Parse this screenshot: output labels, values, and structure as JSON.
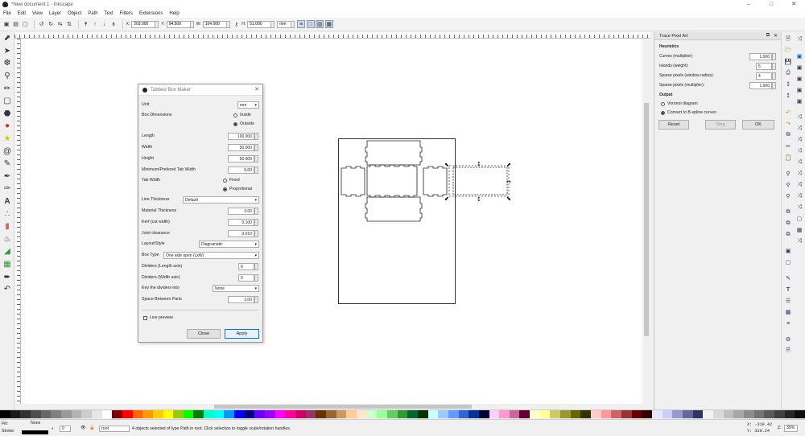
{
  "window": {
    "title": "*New document 1 - Inkscape",
    "controls": [
      "minimize-icon",
      "maximize-icon",
      "close-icon"
    ]
  },
  "menu": [
    "File",
    "Edit",
    "View",
    "Layer",
    "Object",
    "Path",
    "Text",
    "Filters",
    "Extensions",
    "Help"
  ],
  "toolbar": {
    "x_label": "X:",
    "x_value": "203.000",
    "y_label": "Y:",
    "y_value": "94.500",
    "w_label": "W:",
    "w_value": "104.000",
    "h_label": "H:",
    "h_value": "51.000",
    "unit": "mm"
  },
  "left_tools": [
    "select",
    "node",
    "tweak",
    "zoom",
    "measure",
    "rect",
    "3dbox",
    "ellipse",
    "star",
    "spiral",
    "pencil",
    "pen",
    "calligraphy",
    "text",
    "spray",
    "eraser",
    "bucket",
    "gradient",
    "mesh",
    "dropper",
    "connector"
  ],
  "dialog": {
    "title": "Tabbed Box Maker",
    "unit_label": "Unit",
    "unit_value": "mm",
    "box_dims_label": "Box Dimensions",
    "inside": "Inside",
    "outside": "Outside",
    "dims_selected": "outside",
    "length_label": "Length",
    "length_value": "100.000",
    "width_label": "Width",
    "width_value": "50.000",
    "height_label": "Height",
    "height_value": "50.000",
    "tab_min_label": "Minimum/Prefered Tab Width",
    "tab_min_value": "6.00",
    "tab_width_label": "Tab Width",
    "fixed": "Fixed",
    "proportional": "Proportional",
    "tab_selected": "proportional",
    "line_thickness_label": "Line Thickness",
    "line_thickness_value": "Default",
    "material_label": "Material Thickness",
    "material_value": "3.00",
    "kerf_label": "Kerf (cut width)",
    "kerf_value": "0.100",
    "joint_label": "Joint clearance",
    "joint_value": "0.010",
    "layout_label": "Layout/Style",
    "layout_value": "Diagramatic",
    "boxtype_label": "Box Type",
    "boxtype_value": "One side open (LxW)",
    "div_len_label": "Dividers (Length axis)",
    "div_len_value": "0",
    "div_wid_label": "Dividers (Width axis)",
    "div_wid_value": "0",
    "keydiv_label": "Key the dividers into",
    "keydiv_value": "None",
    "space_label": "Space Between Parts",
    "space_value": "1.00",
    "live_preview": "Live preview",
    "close": "Close",
    "apply": "Apply"
  },
  "trace_panel": {
    "title": "Trace Pixel Art",
    "heuristics": "Heuristics",
    "curves_label": "Curves (multiplier):",
    "curves_value": "1.000",
    "islands_label": "Islands (weight):",
    "islands_value": "5",
    "sparse_window_label": "Sparse pixels (window radius):",
    "sparse_window_value": "4",
    "sparse_mult_label": "Sparse pixels (multiplier):",
    "sparse_mult_value": "1.000",
    "output": "Output",
    "voronoi": "Voronoi diagram",
    "bspline": "Convert to B-spline curves",
    "output_selected": "bspline",
    "reset": "Reset",
    "stop": "Stop",
    "ok": "OK"
  },
  "status": {
    "fill_label": "Fill:",
    "stroke_label": "Stroke:",
    "fill_value": "None",
    "opacity": "0",
    "layer": "root",
    "message": "4 objects selected of type Path in root. Click selection to toggle scale/rotation handles.",
    "coords_x": "X: -310.42",
    "coords_y": "Y:  320.24",
    "zoom_label": "Z:",
    "zoom": "35%"
  },
  "palette": [
    "#000000",
    "#1a1a1a",
    "#333333",
    "#4d4d4d",
    "#666666",
    "#808080",
    "#999999",
    "#b3b3b3",
    "#cccccc",
    "#e6e6e6",
    "#ffffff",
    "#800000",
    "#ff0000",
    "#ff6600",
    "#ff9900",
    "#ffcc00",
    "#ffff00",
    "#99cc00",
    "#00ff00",
    "#008000",
    "#00ffcc",
    "#00ffff",
    "#0099ff",
    "#0000ff",
    "#000080",
    "#6600ff",
    "#9900ff",
    "#ff00ff",
    "#ff0099",
    "#cc0066",
    "#993366",
    "#663300",
    "#996633",
    "#cc9966",
    "#ffcc99",
    "#ffe6cc",
    "#ccffcc",
    "#99ff99",
    "#66cc66",
    "#339933",
    "#006633",
    "#003300",
    "#ccffff",
    "#99ccff",
    "#6699ff",
    "#3366cc",
    "#003399",
    "#000033",
    "#ffccff",
    "#ff99cc",
    "#cc6699",
    "#660033",
    "#ffffcc",
    "#ffff99",
    "#cccc66",
    "#999933",
    "#666600",
    "#333300",
    "#ffcccc",
    "#ff9999",
    "#cc6666",
    "#993333",
    "#660000",
    "#330000",
    "#e6e6ff",
    "#ccccff",
    "#9999cc",
    "#666699",
    "#333366",
    "#f2f2f2",
    "#d9d9d9",
    "#bfbfbf",
    "#a6a6a6",
    "#8c8c8c",
    "#737373",
    "#595959",
    "#404040",
    "#262626",
    "#0d0d0d"
  ]
}
